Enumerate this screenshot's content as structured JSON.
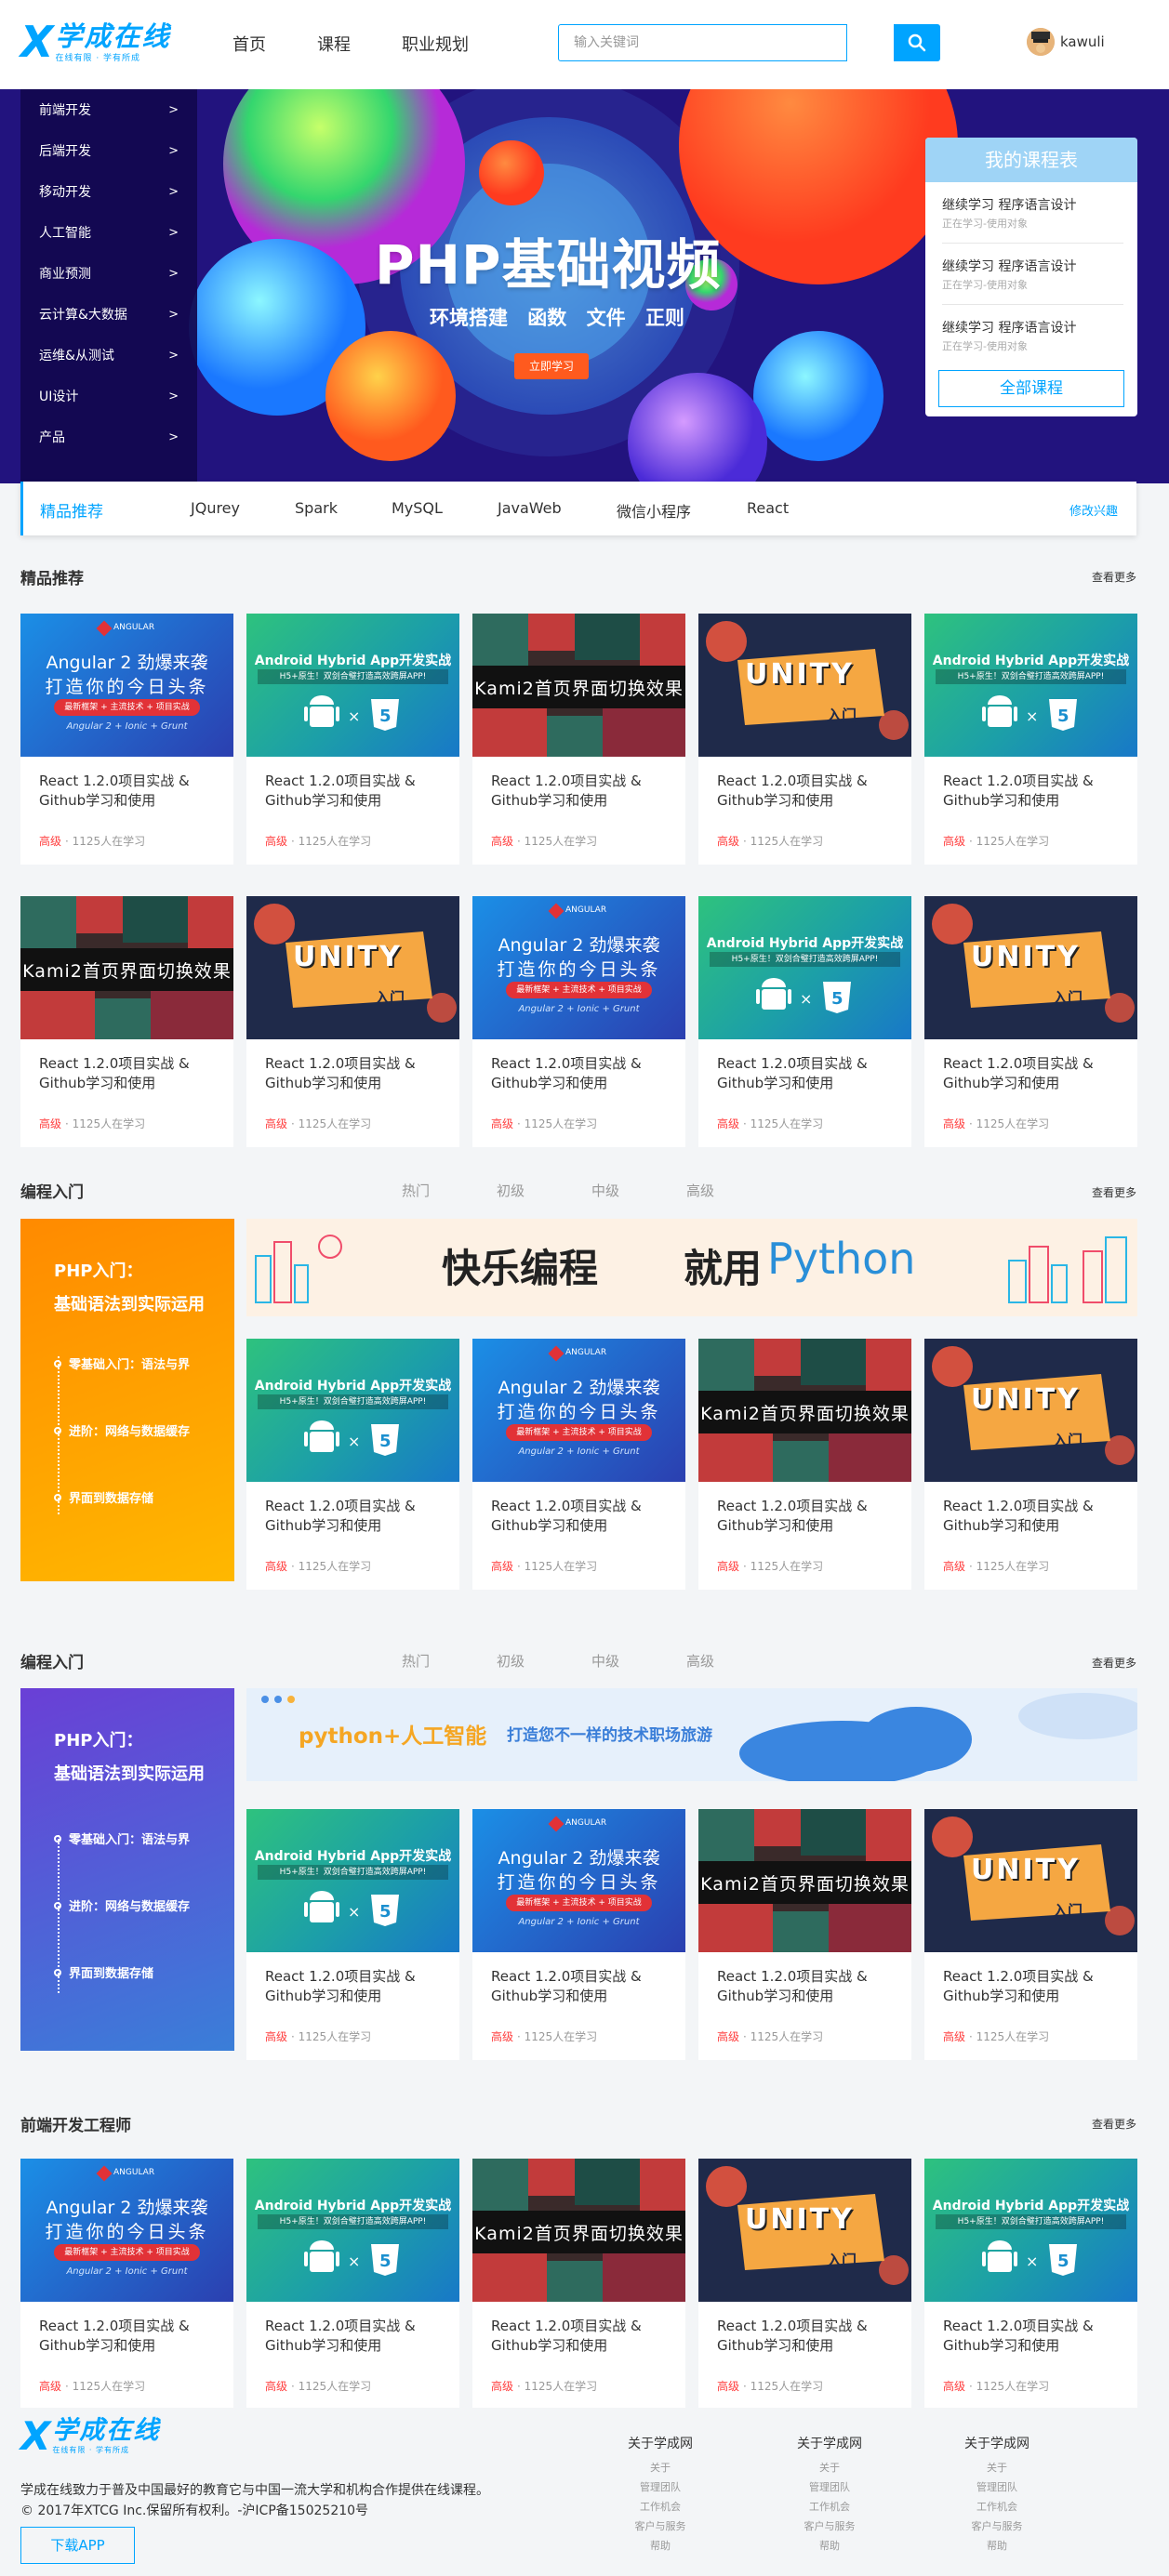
{
  "header": {
    "logo_text": "学成在线",
    "logo_sub": "在线有限 · 学有所成",
    "nav": [
      "首页",
      "课程",
      "职业规划"
    ],
    "search_placeholder": "输入关键词",
    "username": "kawuli"
  },
  "banner": {
    "categories": [
      "前端开发",
      "后端开发",
      "移动开发",
      "人工智能",
      "商业预测",
      "云计算&大数据",
      "运维&从测试",
      "UI设计",
      "产品"
    ],
    "arrow": ">",
    "title": "PHP基础视频",
    "subtitle": "环境搭建 函数 文件 正则",
    "button": "立即学习",
    "my_courses": {
      "title": "我的课程表",
      "items": [
        {
          "title": "继续学习 程序语言设计",
          "sub": "正在学习-使用对象"
        },
        {
          "title": "继续学习 程序语言设计",
          "sub": "正在学习-使用对象"
        },
        {
          "title": "继续学习 程序语言设计",
          "sub": "正在学习-使用对象"
        }
      ],
      "all_button": "全部课程"
    }
  },
  "recommend_bar": {
    "title": "精品推荐",
    "tags": [
      "JQurey",
      "Spark",
      "MySQL",
      "JavaWeb",
      "微信小程序",
      "React"
    ],
    "modify": "修改兴趣"
  },
  "sections": [
    {
      "title": "精品推荐",
      "more": "查看更多"
    },
    {
      "title": "编程入门",
      "more": "查看更多",
      "tabs": [
        "热门",
        "初级",
        "中级",
        "高级"
      ]
    },
    {
      "title": "编程入门",
      "more": "查看更多",
      "tabs": [
        "热门",
        "初级",
        "中级",
        "高级"
      ]
    },
    {
      "title": "前端开发工程师",
      "more": "查看更多"
    }
  ],
  "course": {
    "name": "React 1.2.0项目实战 & Github学习和使用",
    "level": "高级",
    "count": "· 1125人在学习"
  },
  "thumbs": {
    "angular": {
      "brand": "ANGULAR",
      "line1": "Angular 2 劲爆来袭",
      "line2": "打造你的今日头条",
      "tag": "最新框架 + 主流技术 + 项目实战",
      "foot": "Angular 2 + Ionic + Grunt"
    },
    "android": {
      "title": "Android Hybrid App开发实战",
      "tag": "H5+原生！双剑合璧打造高效跨屏APP!"
    },
    "kami": {
      "text": "Kami2首页界面切换效果"
    },
    "unity": {
      "word": "UNITY",
      "sub": "入门"
    }
  },
  "promos": {
    "python_wide": {
      "a": "快乐编程",
      "b": "就用",
      "c": "Python"
    },
    "ai_wide": {
      "a": "python+人工智能",
      "b": "打造您不一样的技术职场旅游"
    },
    "side": {
      "t1": "PHP入门：",
      "t2": "基础语法到实际运用",
      "items": [
        "零基础入门：语法与界",
        "进阶：网络与数据缓存",
        "界面到数据存储"
      ]
    }
  },
  "footer": {
    "desc1": "学成在线致力于普及中国最好的教育它与中国一流大学和机构合作提供在线课程。",
    "desc2": "© 2017年XTCG Inc.保留所有权利。-沪ICP备15025210号",
    "download": "下载APP",
    "columns": [
      {
        "title": "关于学成网",
        "links": [
          "关于",
          "管理团队",
          "工作机会",
          "客户与服务",
          "帮助"
        ]
      },
      {
        "title": "关于学成网",
        "links": [
          "关于",
          "管理团队",
          "工作机会",
          "客户与服务",
          "帮助"
        ]
      },
      {
        "title": "关于学成网",
        "links": [
          "关于",
          "管理团队",
          "工作机会",
          "客户与服务",
          "帮助"
        ]
      }
    ]
  },
  "colors": {
    "accent": "#00a4ff",
    "level": "#ff3d3d",
    "banner_bg": "#22137e",
    "orange_btn": "#ff5a1e"
  }
}
